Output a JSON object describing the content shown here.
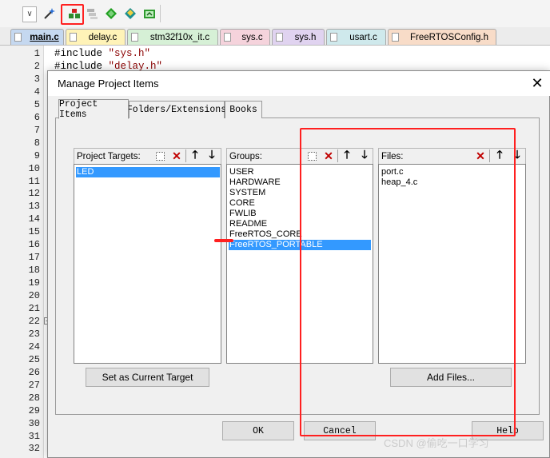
{
  "toolbar": {
    "icons": [
      "dropdown-arrow",
      "magic-wand-icon",
      "manage-project-icon",
      "multi-project-icon",
      "diamond-green-icon",
      "diamond-options-icon",
      "pack-installer-icon"
    ]
  },
  "tabs": [
    {
      "label": "main.c",
      "color": "#c5d8f0",
      "active": true
    },
    {
      "label": "delay.c",
      "color": "#fff3b8"
    },
    {
      "label": "stm32f10x_it.c",
      "color": "#d6f0d6"
    },
    {
      "label": "sys.c",
      "color": "#f5d3dc"
    },
    {
      "label": "sys.h",
      "color": "#e0d3f0"
    },
    {
      "label": "usart.c",
      "color": "#cfe9ec"
    },
    {
      "label": "FreeRTOSConfig.h",
      "color": "#f8dcc8"
    }
  ],
  "editor": {
    "line_numbers": [
      "1",
      "2",
      "3",
      "4",
      "5",
      "6",
      "7",
      "8",
      "9",
      "10",
      "11",
      "12",
      "13",
      "14",
      "15",
      "16",
      "17",
      "18",
      "19",
      "20",
      "21",
      "22",
      "23",
      "24",
      "25",
      "26",
      "27",
      "28",
      "29",
      "30",
      "31",
      "32"
    ],
    "line1_kw": "#include ",
    "line1_str": "\"sys.h\"",
    "line2_kw": "#include ",
    "line2_str": "\"delay.h\""
  },
  "dialog": {
    "title": "Manage Project Items",
    "close_glyph": "✕",
    "tabs": [
      "Project Items",
      "Folders/Extensions",
      "Books"
    ],
    "targets": {
      "header": "Project Targets:",
      "items": [
        "LED"
      ],
      "selected": 0
    },
    "groups": {
      "header": "Groups:",
      "items": [
        "USER",
        "HARDWARE",
        "SYSTEM",
        "CORE",
        "FWLIB",
        "README",
        "FreeRTOS_CORE",
        "FreeRTOS_PORTABLE"
      ],
      "selected": 7
    },
    "files": {
      "header": "Files:",
      "items": [
        "port.c",
        "heap_4.c"
      ]
    },
    "set_target_button": "Set as Current Target",
    "add_files_button": "Add Files...",
    "ok_button": "OK",
    "cancel_button": "Cancel",
    "help_button": "Help"
  },
  "watermark": "CSDN @偷吃一口学习",
  "annotation_color": "#ff2020"
}
